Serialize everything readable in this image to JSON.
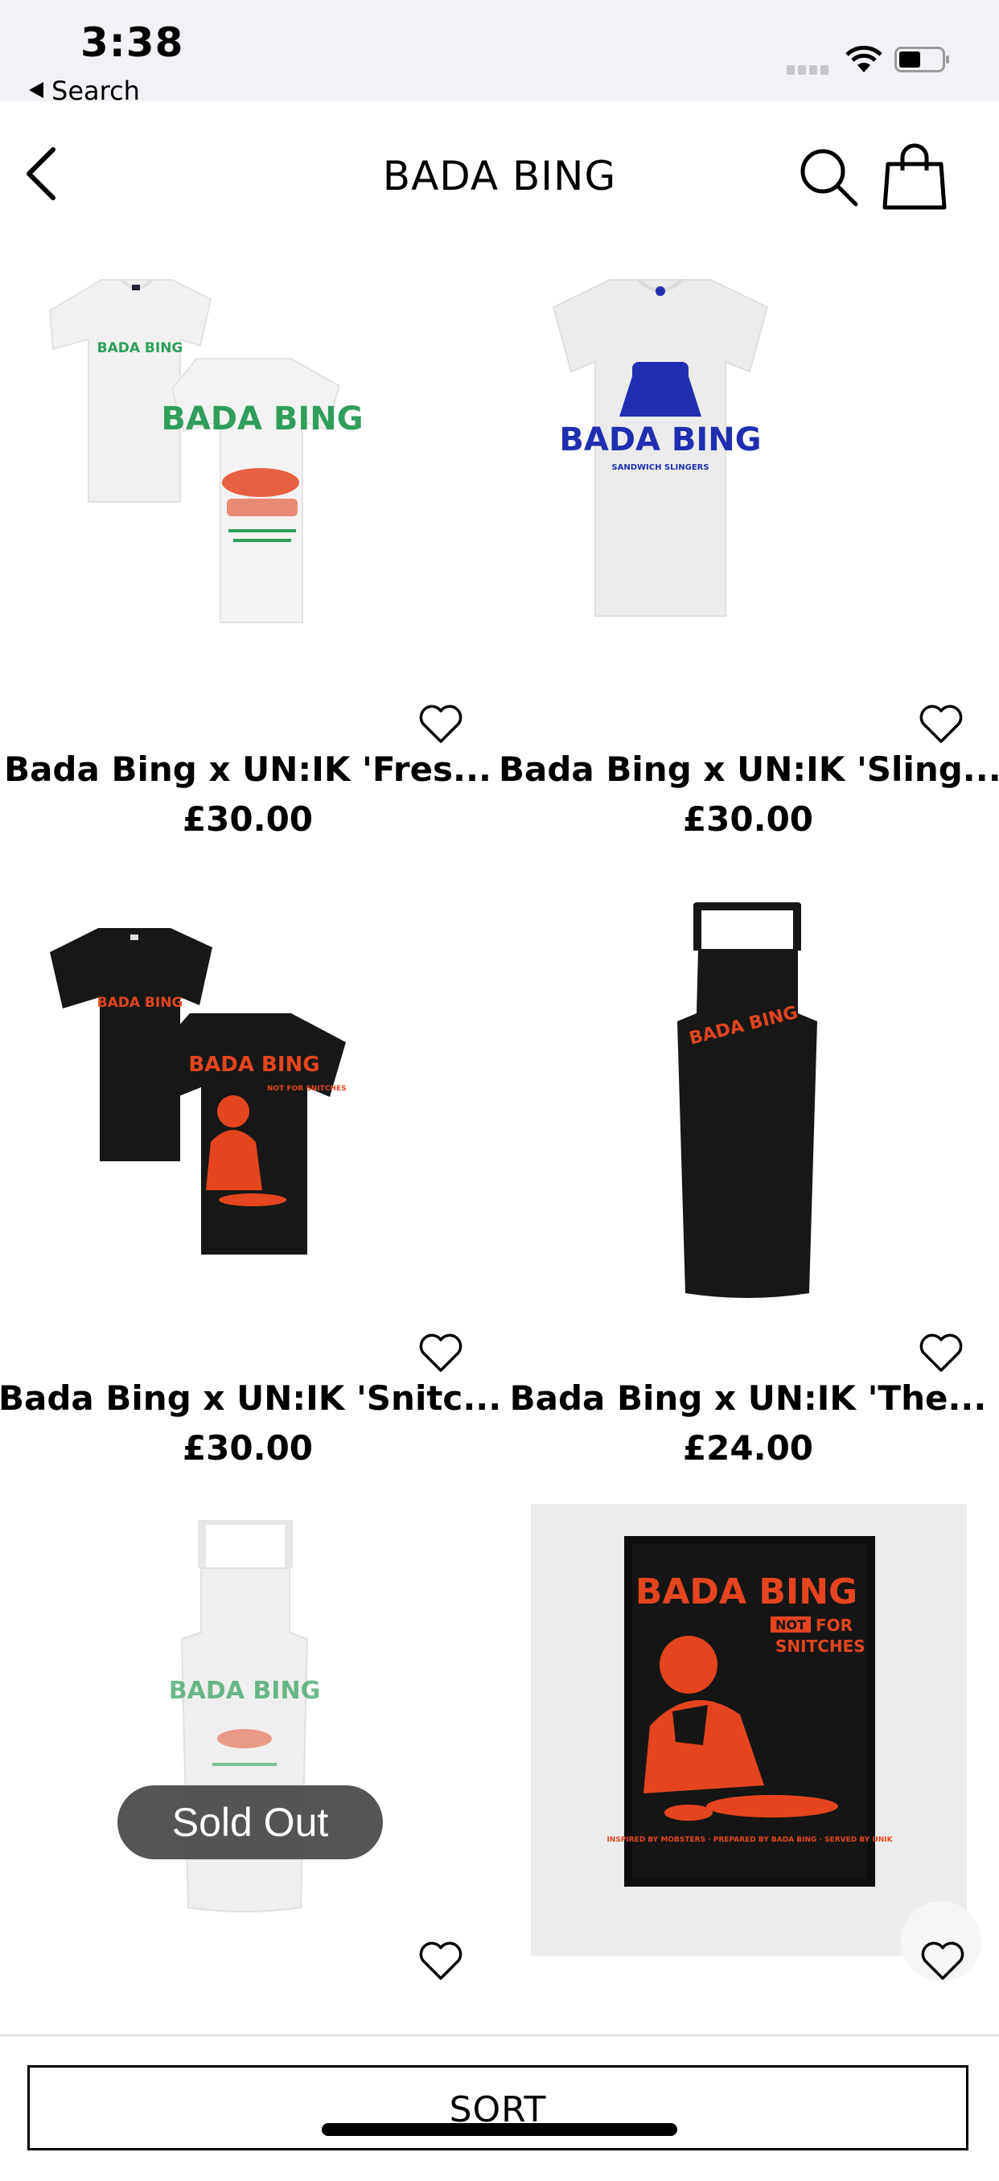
{
  "status_bar": {
    "time": "3:38",
    "back_app_label": "Search"
  },
  "nav": {
    "title": "BADA BING"
  },
  "products": [
    {
      "name": "Bada Bing x UN:IK 'Fres...",
      "price": "£30.00"
    },
    {
      "name": "Bada Bing x UN:IK 'Sling...",
      "price": "£30.00"
    },
    {
      "name": "Bada Bing x UN:IK 'Snitc...",
      "price": "£30.00"
    },
    {
      "name": "Bada Bing x UN:IK 'The...",
      "price": "£24.00"
    },
    {
      "name": "",
      "price": "",
      "badge": "Sold Out"
    },
    {
      "name": "",
      "price": ""
    }
  ],
  "product_artwork": {
    "p1_front": "BADA BING",
    "p1_back": "BADA BING",
    "p2": "BADA BING",
    "p2_sub": "SANDWICH SLINGERS",
    "p3": "BADA BING",
    "p3_back": "BADA BING",
    "p3_note": "NOT FOR SNITCHES",
    "p4": "BADA BING",
    "p5": "BADA BING",
    "p6_title": "BADA BING",
    "p6_not": "NOT",
    "p6_for": "FOR",
    "p6_snitches": "SNITCHES",
    "p6_foot": "INSPIRED BY MOBSTERS · PREPARED BY BADA BING · SERVED BY UNIK"
  },
  "sort_bar": {
    "label": "SORT"
  },
  "colors": {
    "green": "#2f9e5c",
    "blue": "#1f2fb0",
    "orange_red": "#e4451f",
    "shirt_black": "#171717",
    "status_bg": "#f2f2f6"
  },
  "icons": [
    "chevron-left-icon",
    "search-icon",
    "shopping-bag-icon",
    "heart-outline-icon",
    "wifi-icon",
    "battery-icon"
  ]
}
